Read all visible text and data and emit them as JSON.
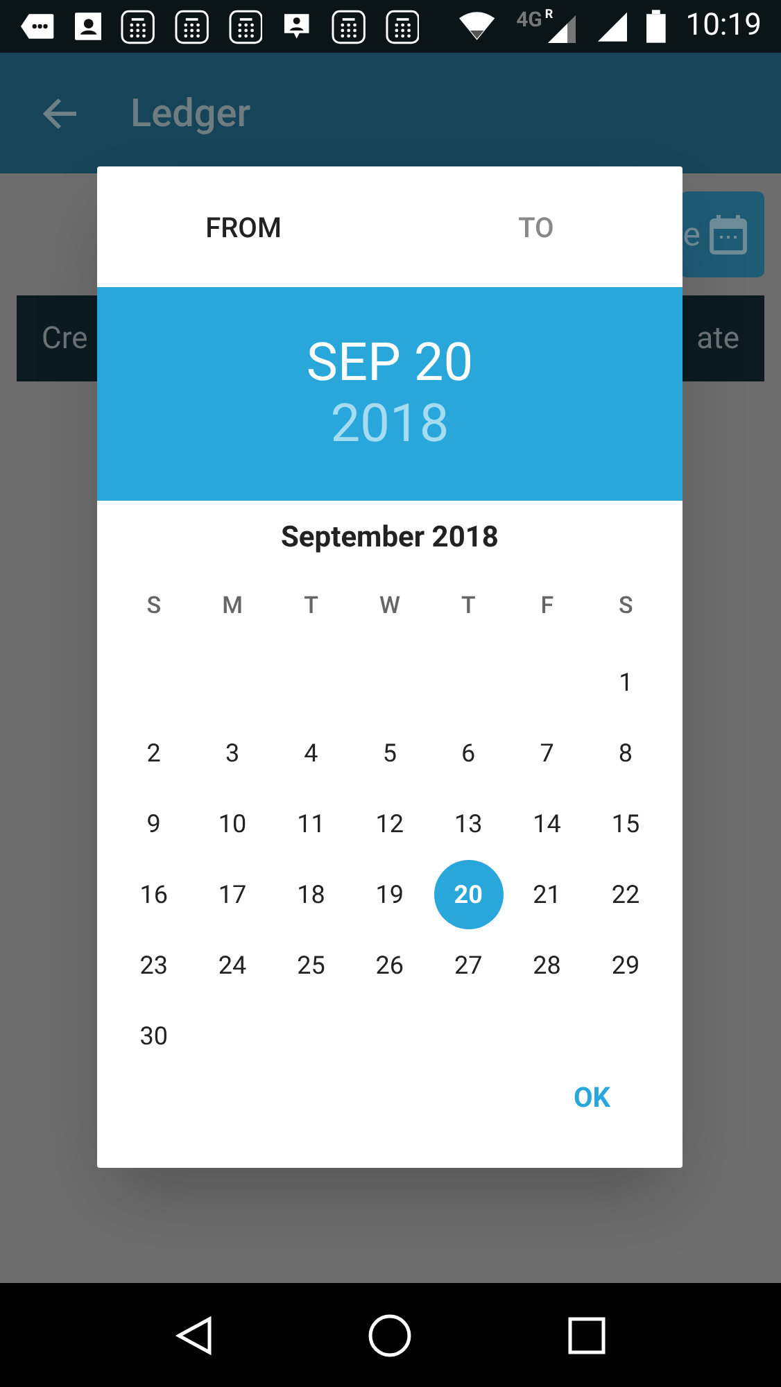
{
  "status_bar": {
    "time": "10:19",
    "network": "4G",
    "roaming": "R"
  },
  "app_bar": {
    "title": "Ledger"
  },
  "background": {
    "date_button_text": "e",
    "header_left": "Cre",
    "header_right": "ate"
  },
  "dialog": {
    "tabs": [
      {
        "label": "FROM",
        "selected": true
      },
      {
        "label": "TO",
        "selected": false
      }
    ],
    "header": {
      "date": "SEP 20",
      "year": "2018"
    },
    "month_title": "September 2018",
    "weekdays": [
      "S",
      "M",
      "T",
      "W",
      "T",
      "F",
      "S"
    ],
    "weeks": [
      {
        "kind": "first",
        "days": [
          {
            "label": "1",
            "selected": false
          }
        ]
      },
      {
        "kind": "full",
        "days": [
          {
            "label": "2",
            "selected": false
          },
          {
            "label": "3",
            "selected": false
          },
          {
            "label": "4",
            "selected": false
          },
          {
            "label": "5",
            "selected": false
          },
          {
            "label": "6",
            "selected": false
          },
          {
            "label": "7",
            "selected": false
          },
          {
            "label": "8",
            "selected": false
          }
        ]
      },
      {
        "kind": "full",
        "days": [
          {
            "label": "9",
            "selected": false
          },
          {
            "label": "10",
            "selected": false
          },
          {
            "label": "11",
            "selected": false
          },
          {
            "label": "12",
            "selected": false
          },
          {
            "label": "13",
            "selected": false
          },
          {
            "label": "14",
            "selected": false
          },
          {
            "label": "15",
            "selected": false
          }
        ]
      },
      {
        "kind": "full",
        "days": [
          {
            "label": "16",
            "selected": false
          },
          {
            "label": "17",
            "selected": false
          },
          {
            "label": "18",
            "selected": false
          },
          {
            "label": "19",
            "selected": false
          },
          {
            "label": "20",
            "selected": true
          },
          {
            "label": "21",
            "selected": false
          },
          {
            "label": "22",
            "selected": false
          }
        ]
      },
      {
        "kind": "full",
        "days": [
          {
            "label": "23",
            "selected": false
          },
          {
            "label": "24",
            "selected": false
          },
          {
            "label": "25",
            "selected": false
          },
          {
            "label": "26",
            "selected": false
          },
          {
            "label": "27",
            "selected": false
          },
          {
            "label": "28",
            "selected": false
          },
          {
            "label": "29",
            "selected": false
          }
        ]
      },
      {
        "kind": "last",
        "days": [
          {
            "label": "30",
            "selected": false
          }
        ]
      }
    ],
    "ok_button": "OK"
  }
}
